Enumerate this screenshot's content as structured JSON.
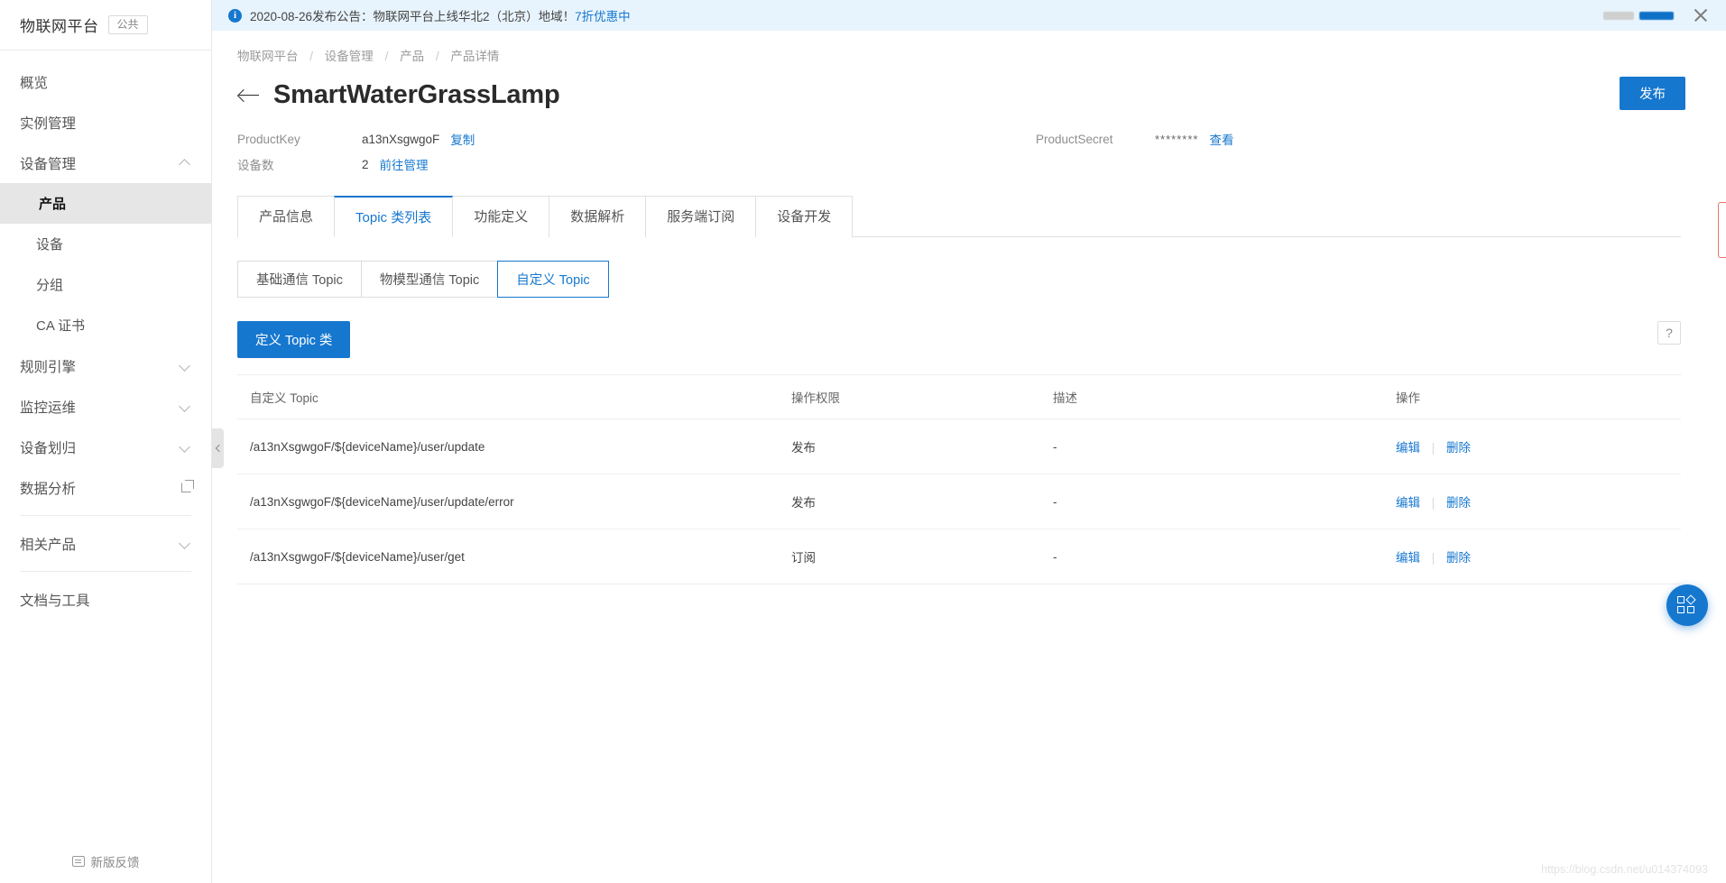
{
  "sidebar": {
    "brand": {
      "name": "物联网平台",
      "tag": "公共"
    },
    "items": [
      {
        "label": "概览",
        "type": "item",
        "active": false,
        "expandable": false
      },
      {
        "label": "实例管理",
        "type": "item",
        "active": false,
        "expandable": false
      },
      {
        "label": "设备管理",
        "type": "group",
        "active": false,
        "expandable": true,
        "expanded": true
      },
      {
        "label": "产品",
        "type": "sub",
        "active": true,
        "expandable": false
      },
      {
        "label": "设备",
        "type": "sub",
        "active": false,
        "expandable": false
      },
      {
        "label": "分组",
        "type": "sub",
        "active": false,
        "expandable": false
      },
      {
        "label": "CA 证书",
        "type": "sub",
        "active": false,
        "expandable": false
      },
      {
        "label": "规则引擎",
        "type": "group",
        "active": false,
        "expandable": true,
        "expanded": false
      },
      {
        "label": "监控运维",
        "type": "group",
        "active": false,
        "expandable": true,
        "expanded": false
      },
      {
        "label": "设备划归",
        "type": "group",
        "active": false,
        "expandable": true,
        "expanded": false
      },
      {
        "label": "数据分析",
        "type": "item",
        "active": false,
        "expandable": false,
        "external": true
      },
      {
        "label": "相关产品",
        "type": "group",
        "active": false,
        "expandable": true,
        "expanded": false
      },
      {
        "label": "文档与工具",
        "type": "item",
        "active": false,
        "expandable": false
      }
    ],
    "feedback_label": "新版反馈"
  },
  "notice": {
    "text": "2020-08-26发布公告：物联网平台上线华北2（北京）地域！",
    "link_text": "7折优惠中"
  },
  "breadcrumb": {
    "items": [
      "物联网平台",
      "设备管理",
      "产品",
      "产品详情"
    ],
    "separator": "/"
  },
  "header": {
    "title": "SmartWaterGrassLamp",
    "publish_label": "发布"
  },
  "meta": {
    "product_key_label": "ProductKey",
    "product_key_value": "a13nXsgwgoF",
    "copy_label": "复制",
    "device_count_label": "设备数",
    "device_count_value": "2",
    "device_manage_label": "前往管理",
    "product_secret_label": "ProductSecret",
    "product_secret_value": "********",
    "view_label": "查看"
  },
  "tabs": [
    {
      "label": "产品信息",
      "active": false
    },
    {
      "label": "Topic 类列表",
      "active": true
    },
    {
      "label": "功能定义",
      "active": false
    },
    {
      "label": "数据解析",
      "active": false
    },
    {
      "label": "服务端订阅",
      "active": false
    },
    {
      "label": "设备开发",
      "active": false
    }
  ],
  "subtabs": [
    {
      "label": "基础通信 Topic",
      "active": false
    },
    {
      "label": "物模型通信 Topic",
      "active": false
    },
    {
      "label": "自定义 Topic",
      "active": true
    }
  ],
  "toolbar": {
    "define_topic_label": "定义 Topic 类",
    "help_label": "?"
  },
  "table": {
    "columns": [
      "自定义 Topic",
      "操作权限",
      "描述",
      "操作"
    ],
    "rows": [
      {
        "topic": "/a13nXsgwgoF/${deviceName}/user/update",
        "permission": "发布",
        "description": "-",
        "edit": "编辑",
        "delete": "删除"
      },
      {
        "topic": "/a13nXsgwgoF/${deviceName}/user/update/error",
        "permission": "发布",
        "description": "-",
        "edit": "编辑",
        "delete": "删除"
      },
      {
        "topic": "/a13nXsgwgoF/${deviceName}/user/get",
        "permission": "订阅",
        "description": "-",
        "edit": "编辑",
        "delete": "删除"
      }
    ]
  },
  "watermark": "https://blog.csdn.net/u014374093",
  "colors": {
    "accent": "#1677cf",
    "notice_bg": "#e8f4fd",
    "sidebar_active_bg": "#e6e6e6",
    "edge_tab_border": "#e8736a"
  }
}
